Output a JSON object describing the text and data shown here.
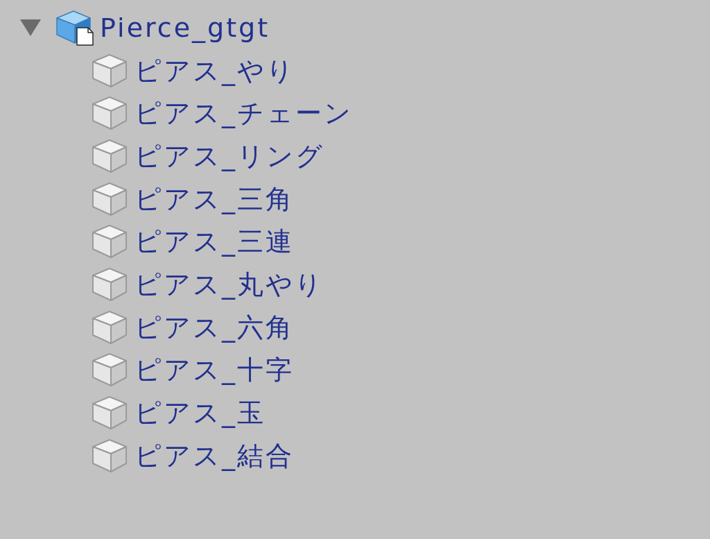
{
  "hierarchy": {
    "items": [
      {
        "label": "Pierce_gtgt",
        "kind": "prefab",
        "expanded": true,
        "children": [
          {
            "label": "ピアス_やり",
            "kind": "object"
          },
          {
            "label": "ピアス_チェーン",
            "kind": "object"
          },
          {
            "label": "ピアス_リング",
            "kind": "object"
          },
          {
            "label": "ピアス_三角",
            "kind": "object"
          },
          {
            "label": "ピアス_三連",
            "kind": "object"
          },
          {
            "label": "ピアス_丸やり",
            "kind": "object"
          },
          {
            "label": "ピアス_六角",
            "kind": "object"
          },
          {
            "label": "ピアス_十字",
            "kind": "object"
          },
          {
            "label": "ピアス_玉",
            "kind": "object"
          },
          {
            "label": "ピアス_結合",
            "kind": "object"
          }
        ]
      }
    ]
  }
}
